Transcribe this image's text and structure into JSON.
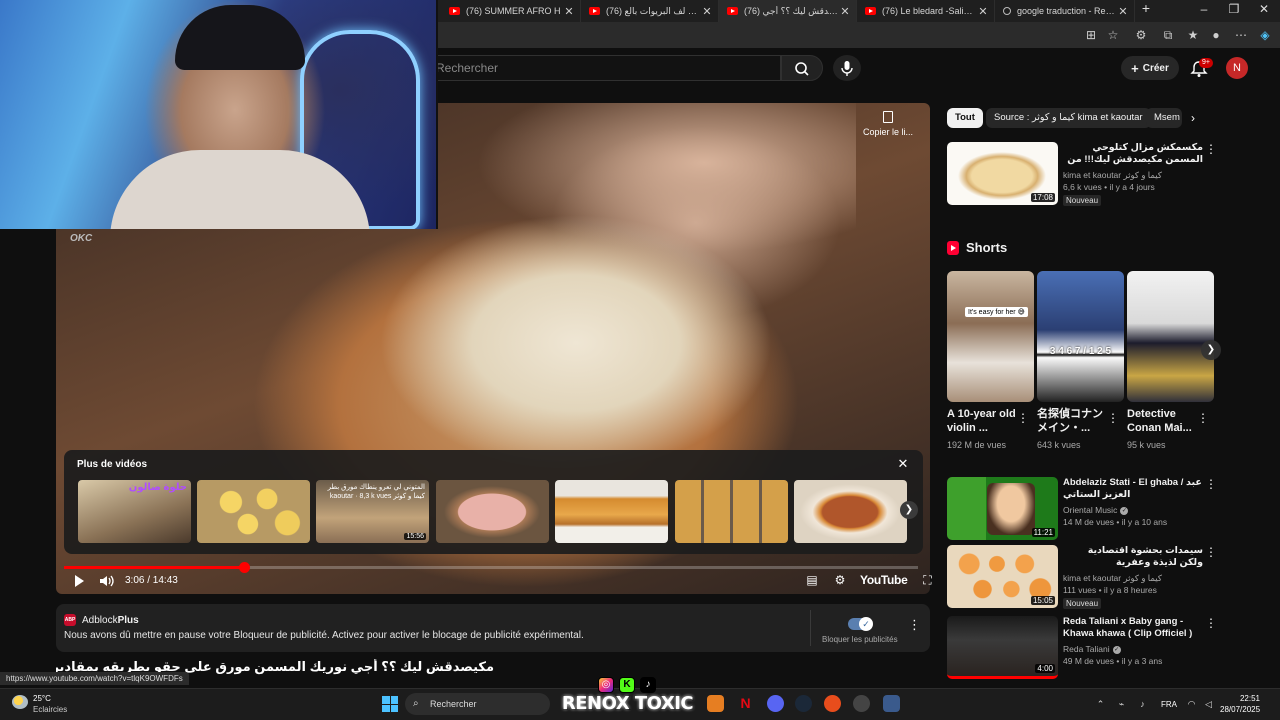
{
  "browser": {
    "tabs": [
      {
        "label": "(76) SUMMER AFRO H",
        "icon": "youtube-favicon"
      },
      {
        "label": "(76) طريقة لف البريوات بالع",
        "icon": "youtube-favicon"
      },
      {
        "label": "(76) مكيصدقش ليك ؟؟ أجي",
        "icon": "youtube-favicon",
        "active": true
      },
      {
        "label": "(76) Le bledard -Salina (clai",
        "icon": "youtube-favicon"
      },
      {
        "label": "google traduction - Recher",
        "icon": "search-favicon"
      }
    ],
    "status_url": "https://www.youtube.com/watch?v=tlqK9OWFDFs"
  },
  "youtube": {
    "search_placeholder": "Rechercher",
    "create_label": "Créer",
    "notif_count": "9+",
    "avatar_letter": "N"
  },
  "player": {
    "copy_link_label": "Copier le li...",
    "more_videos_title": "Plus de vidéos",
    "time": "3:06 / 14:43",
    "progress": 0.211,
    "logo": "YouTube",
    "thumbnails": [
      {
        "overlay": "حلوة صالون",
        "duration": ""
      },
      {
        "overlay": "",
        "duration": ""
      },
      {
        "overlay": "المتوني لي تعرو ينطاك مورق بطر kaoutar · 8,3 k vues كيما و كوثر",
        "duration": "15:56"
      },
      {
        "overlay": "",
        "duration": ""
      },
      {
        "overlay": "",
        "duration": ""
      },
      {
        "overlay": "",
        "duration": ""
      },
      {
        "overlay": "",
        "duration": ""
      }
    ]
  },
  "adblock": {
    "name_prefix": "Adblock",
    "name_suffix": "Plus",
    "logo_text": "ABP",
    "message": "Nous avons dû mettre en pause votre Bloqueur de publicité. Activez pour activer le blocage de publicité expérimental.",
    "toggle_label": "Bloquer les publicités"
  },
  "video_title": "مكيصدقش ليك ؟؟ أجي نوريك المسمن مورق على حقو بطريقه بمقادير مظبوطه على بالك",
  "chips": [
    {
      "label": "Tout",
      "active": true
    },
    {
      "label": "Source : كيما و كوثر kima et kaoutar",
      "active": false
    },
    {
      "label": "Msem",
      "active": false
    }
  ],
  "related": [
    {
      "title": "مكسمكش مزال كتلوحي المسمن مكيصدقش ليك!!! من اليوم متيقاش يخطاك شحال كيجي",
      "channel": "kima et kaoutar كيما و كوثر",
      "meta": "6,6 k vues • il y a 4 jours",
      "badge": "Nouveau",
      "duration": "17:08",
      "verified": false
    },
    {
      "title": "Abdelaziz Stati - El ghaba / عبد العزيز الستاتي",
      "channel": "Oriental Music",
      "meta": "14 M de vues • il y a 10 ans",
      "badge": "",
      "duration": "11:21",
      "verified": true
    },
    {
      "title": "سيمدات بحشوة اقتصادية ولكن لذيذة وعفرية مغتغايهوش الحلكة",
      "channel": "kima et kaoutar كيما و كوثر",
      "meta": "111 vues • il y a 8 heures",
      "badge": "Nouveau",
      "duration": "15:05",
      "verified": false
    },
    {
      "title": "Reda Taliani x Baby gang - Khawa khawa ( Clip Officiel )",
      "channel": "Reda Taliani",
      "meta": "49 M de vues • il y a 3 ans",
      "badge": "",
      "duration": "4:00",
      "verified": true
    }
  ],
  "shorts": {
    "heading": "Shorts",
    "items": [
      {
        "title": "A 10-year old violin ...",
        "views": "192 M de vues",
        "overlay": "It's easy for her 😅"
      },
      {
        "title": "名探偵コナン メイン・...",
        "views": "643 k vues",
        "overlay": "3 4 6 7 / 1 2 5"
      },
      {
        "title": "Detective Conan Mai...",
        "views": "95 k vues",
        "overlay": ""
      }
    ]
  },
  "taskbar": {
    "weather_temp": "25°C",
    "weather_desc": "Eclaircies",
    "search_label": "Rechercher",
    "lang": "FRA",
    "time": "22:51",
    "date": "28/07/2025"
  },
  "streamer": {
    "name": "RENOX TOXIC",
    "webcam_logo": "OKC"
  },
  "colors": {
    "accent_red": "#ff0000",
    "bg": "#0f0f0f",
    "chip_bg": "#272727"
  }
}
